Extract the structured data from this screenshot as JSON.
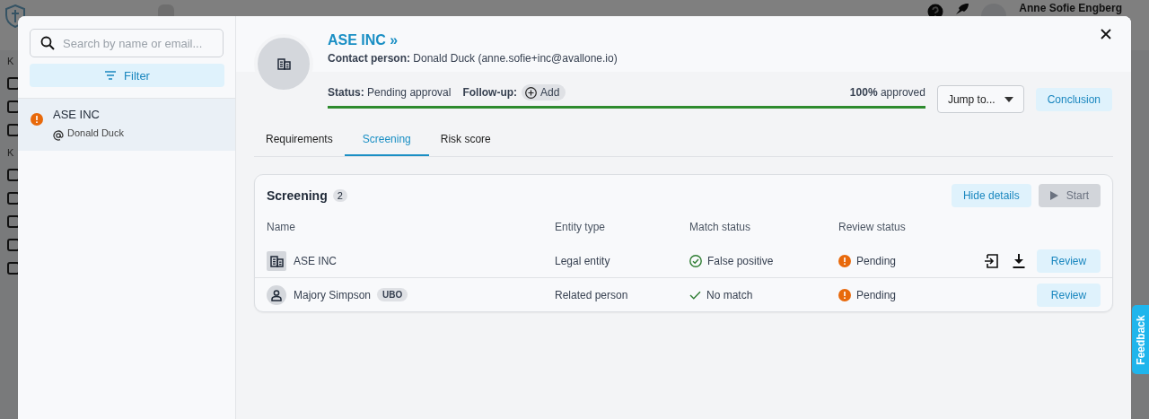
{
  "app": {
    "user": {
      "name": "Anne Sofie Engberg"
    },
    "sidebar_labels": [
      "K",
      "K"
    ]
  },
  "modal": {
    "search": {
      "placeholder": "Search by name or email..."
    },
    "filter_button": "Filter",
    "list": [
      {
        "name": "ASE INC",
        "contact": "Donald Duck",
        "selected": true,
        "alert": true
      }
    ],
    "header": {
      "title": "ASE INC »",
      "contact_label": "Contact person:",
      "contact_value": "Donald Duck (anne.sofie+inc@avallone.io)",
      "status_label": "Status:",
      "status_value": "Pending approval",
      "followup_label": "Follow-up:",
      "add_button": "Add",
      "progress": {
        "level": 1,
        "percent": "100%",
        "suffix": "approved"
      },
      "jump_to": "Jump to...",
      "conclusion_button": "Conclusion"
    },
    "tabs": [
      {
        "label": "Requirements",
        "selected": false
      },
      {
        "label": "Screening",
        "selected": true
      },
      {
        "label": "Risk score",
        "selected": false
      }
    ],
    "screening": {
      "title": "Screening",
      "count": "2",
      "hide_details_button": "Hide details",
      "start_button": {
        "label": "Start",
        "disabled": true
      },
      "columns": [
        "Name",
        "Entity type",
        "Match status",
        "Review status"
      ],
      "rows": [
        {
          "kind": "entity",
          "name": "ASE INC",
          "entity_type": "Legal entity",
          "match_status": {
            "kind": "resolved",
            "text": "False positive"
          },
          "review_status": "Pending",
          "actions": [
            {
              "kind": "import"
            },
            {
              "kind": "download"
            }
          ],
          "review_button": "Review"
        },
        {
          "kind": "person",
          "name": "Majory Simpson",
          "badge": "UBO",
          "entity_type": "Related person",
          "match_status": {
            "kind": "clear",
            "text": "No match"
          },
          "review_status": "Pending",
          "review_button": "Review"
        }
      ]
    }
  },
  "feedback_tab": "Feedback"
}
